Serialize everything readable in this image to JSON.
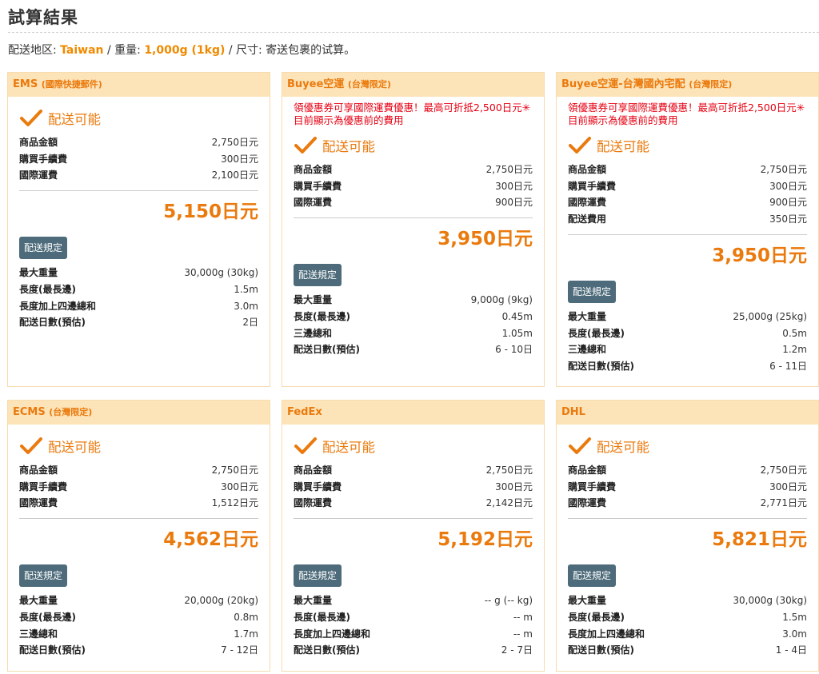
{
  "page": {
    "title": "試算結果",
    "summary": {
      "region_label": "配送地区: ",
      "region": "Taiwan",
      "sep1": " / 重量: ",
      "weight": "1,000g",
      "weight_paren_open": " (",
      "weight_kg": "1kg",
      "weight_paren_close": ")",
      "sep2": " / 尺寸: 寄送包裹的试算。"
    }
  },
  "cards": [
    {
      "name": "EMS",
      "sub": "(國際快捷郵件)",
      "status": "配送可能",
      "fees": [
        {
          "label": "商品金額",
          "value": "2,750日元"
        },
        {
          "label": "購買手續費",
          "value": "300日元"
        },
        {
          "label": "國際運費",
          "value": "2,100日元"
        }
      ],
      "total": "5,150日元",
      "rule_button": "配送規定",
      "specs": [
        {
          "label": "最大重量",
          "value": "30,000g (30kg)"
        },
        {
          "label": "長度(最長邊)",
          "value": "1.5m"
        },
        {
          "label": "長度加上四邊總和",
          "value": "3.0m"
        },
        {
          "label": "配送日數(預估)",
          "value": "2日"
        }
      ]
    },
    {
      "name": "Buyee空運",
      "sub": "(台灣限定)",
      "promo": "領優惠券可享國際運費優惠！最高可折抵2,500日元✳目前顯示為優惠前的費用",
      "status": "配送可能",
      "fees": [
        {
          "label": "商品金額",
          "value": "2,750日元"
        },
        {
          "label": "購買手續費",
          "value": "300日元"
        },
        {
          "label": "國際運費",
          "value": "900日元"
        }
      ],
      "total": "3,950日元",
      "rule_button": "配送規定",
      "specs": [
        {
          "label": "最大重量",
          "value": "9,000g (9kg)"
        },
        {
          "label": "長度(最長邊)",
          "value": "0.45m"
        },
        {
          "label": "三邊總和",
          "value": "1.05m"
        },
        {
          "label": "配送日數(預估)",
          "value": "6 - 10日"
        }
      ]
    },
    {
      "name": "Buyee空運-台灣國內宅配",
      "sub": "(台灣限定)",
      "promo": "領優惠券可享國際運費優惠！最高可折抵2,500日元✳目前顯示為優惠前的費用",
      "status": "配送可能",
      "fees": [
        {
          "label": "商品金額",
          "value": "2,750日元"
        },
        {
          "label": "購買手續費",
          "value": "300日元"
        },
        {
          "label": "國際運費",
          "value": "900日元"
        },
        {
          "label": "配送費用",
          "value": "350日元"
        }
      ],
      "total": "3,950日元",
      "rule_button": "配送規定",
      "specs": [
        {
          "label": "最大重量",
          "value": "25,000g (25kg)"
        },
        {
          "label": "長度(最長邊)",
          "value": "0.5m"
        },
        {
          "label": "三邊總和",
          "value": "1.2m"
        },
        {
          "label": "配送日數(預估)",
          "value": "6 - 11日"
        }
      ]
    },
    {
      "name": "ECMS",
      "sub": "(台灣限定)",
      "status": "配送可能",
      "fees": [
        {
          "label": "商品金額",
          "value": "2,750日元"
        },
        {
          "label": "購買手續費",
          "value": "300日元"
        },
        {
          "label": "國際運費",
          "value": "1,512日元"
        }
      ],
      "total": "4,562日元",
      "rule_button": "配送規定",
      "specs": [
        {
          "label": "最大重量",
          "value": "20,000g (20kg)"
        },
        {
          "label": "長度(最長邊)",
          "value": "0.8m"
        },
        {
          "label": "三邊總和",
          "value": "1.7m"
        },
        {
          "label": "配送日數(預估)",
          "value": "7 - 12日"
        }
      ]
    },
    {
      "name": "FedEx",
      "sub": "",
      "status": "配送可能",
      "fees": [
        {
          "label": "商品金額",
          "value": "2,750日元"
        },
        {
          "label": "購買手續費",
          "value": "300日元"
        },
        {
          "label": "國際運費",
          "value": "2,142日元"
        }
      ],
      "total": "5,192日元",
      "rule_button": "配送規定",
      "specs": [
        {
          "label": "最大重量",
          "value": "-- g (-- kg)"
        },
        {
          "label": "長度(最長邊)",
          "value": "-- m"
        },
        {
          "label": "長度加上四邊總和",
          "value": "-- m"
        },
        {
          "label": "配送日數(預估)",
          "value": "2 - 7日"
        }
      ]
    },
    {
      "name": "DHL",
      "sub": "",
      "status": "配送可能",
      "fees": [
        {
          "label": "商品金額",
          "value": "2,750日元"
        },
        {
          "label": "購買手續費",
          "value": "300日元"
        },
        {
          "label": "國際運費",
          "value": "2,771日元"
        }
      ],
      "total": "5,821日元",
      "rule_button": "配送規定",
      "specs": [
        {
          "label": "最大重量",
          "value": "30,000g (30kg)"
        },
        {
          "label": "長度(最長邊)",
          "value": "1.5m"
        },
        {
          "label": "長度加上四邊總和",
          "value": "3.0m"
        },
        {
          "label": "配送日數(預估)",
          "value": "1 - 4日"
        }
      ]
    }
  ],
  "colors": {
    "accent": "#ea7a0d",
    "header_bg": "#fde3b8",
    "promo": "#e60012",
    "button": "#4d6b7a"
  },
  "icons": {
    "status": "checkmark-icon"
  }
}
